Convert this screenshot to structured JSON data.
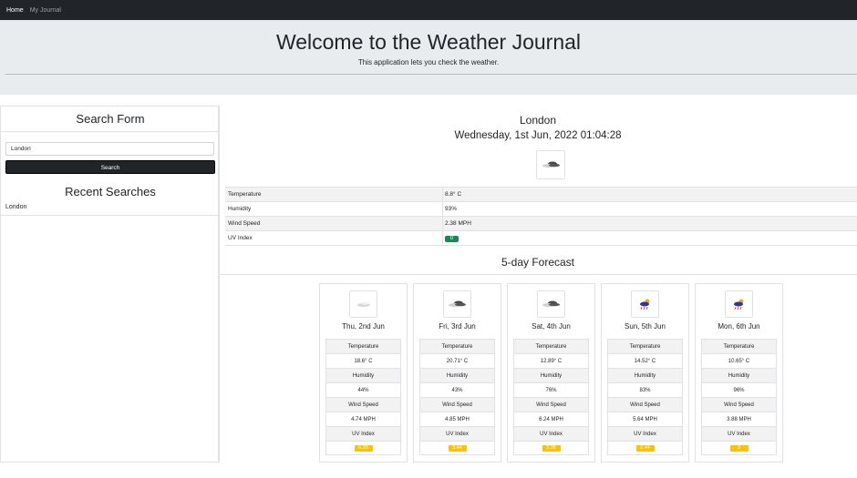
{
  "navbar": {
    "home": "Home",
    "journal": "My Journal"
  },
  "header": {
    "title": "Welcome to the Weather Journal",
    "subtitle": "This application lets you check the weather."
  },
  "search": {
    "title": "Search Form",
    "input_value": "London",
    "button_label": "Search",
    "recent_title": "Recent Searches",
    "recent": [
      "London"
    ]
  },
  "current": {
    "city": "London",
    "datetime": "Wednesday, 1st Jun, 2022 01:04:28",
    "icon": "broken-clouds-icon",
    "rows": [
      {
        "label": "Temperature",
        "value": "8.8° C"
      },
      {
        "label": "Humidity",
        "value": "93%"
      },
      {
        "label": "Wind Speed",
        "value": "2.38 MPH"
      },
      {
        "label": "UV Index",
        "value": "0"
      }
    ]
  },
  "forecast": {
    "title": "5-day Forecast",
    "labels": {
      "temperature": "Temperature",
      "humidity": "Humidity",
      "wind": "Wind Speed",
      "uv": "UV Index"
    },
    "days": [
      {
        "date": "Thu, 2nd Jun",
        "icon": "few-clouds-icon",
        "temperature": "18.6° C",
        "humidity": "44%",
        "wind": "4.74 MPH",
        "uv": "6.29"
      },
      {
        "date": "Fri, 3rd Jun",
        "icon": "broken-clouds-icon",
        "temperature": "20.71° C",
        "humidity": "43%",
        "wind": "4.85 MPH",
        "uv": "3.44"
      },
      {
        "date": "Sat, 4th Jun",
        "icon": "broken-clouds-icon",
        "temperature": "12.89° C",
        "humidity": "76%",
        "wind": "6.24 MPH",
        "uv": "3.36"
      },
      {
        "date": "Sun, 5th Jun",
        "icon": "rain-icon",
        "temperature": "14.52° C",
        "humidity": "83%",
        "wind": "5.64 MPH",
        "uv": "2.44"
      },
      {
        "date": "Mon, 6th Jun",
        "icon": "rain-icon",
        "temperature": "10.65° C",
        "humidity": "96%",
        "wind": "3.88 MPH",
        "uv": "3"
      }
    ]
  },
  "colors": {
    "navbar": "#212529",
    "header_bg": "#e9ecef",
    "uv_low": "#198754",
    "uv_moderate": "#ffc107"
  }
}
